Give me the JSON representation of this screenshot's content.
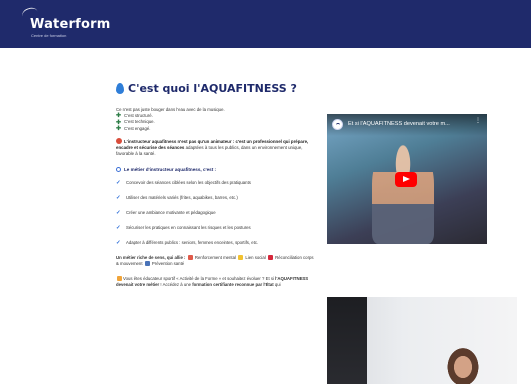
{
  "header": {
    "logo_text": "Waterform",
    "logo_subtitle": "Centre de formation"
  },
  "main": {
    "title": "C'est quoi l'AQUAFITNESS ?",
    "intro": "Ce n'est pas juste bouger dans l'eau avec de la musique.",
    "intro_items": [
      "C'est structuré.",
      "C'est technique.",
      "C'est engagé."
    ],
    "instructor_para_lead": "L'instructeur aquafitness n'est pas qu'un animateur : c'est un professionnel qui prépare, encadre et sécurise des séances",
    "instructor_para_tail": " adaptées à tous les publics, dans un environnement unique, favorable à la santé.",
    "job_heading": "Le métier d'instructeur aquafitness, c'est :",
    "job_items": [
      "Concevoir des séances ciblées selon les objectifs des pratiquants",
      "Utiliser des matériels variés (frites, aquabikes, barres, etc.)",
      "Créer une ambiance motivante et pédagogique",
      "Sécuriser les pratiques en connaissant les risques et les postures",
      "Adapter à différents publics : seniors, femmes enceintes, sportifs, etc."
    ],
    "values_lead": "Un métier riche de sens, qui allie :",
    "values_text_1": " Renforcement mental",
    "values_text_2": " Lien social",
    "values_text_3": " Réconciliation corps & mouvement",
    "values_text_4": " Prévention santé",
    "cta_1": "Vous êtes éducateur sportif « Activité de la Forme » et souhaitez évoluer ? Et si ",
    "cta_bold": "l'AQUAFITNESS devenait votre métier",
    "cta_2": " ! Accédez à une ",
    "cta_bold_2": "formation certifiante reconnue par l'État",
    "cta_3": " qui"
  },
  "video": {
    "title": "Et si l'AQUAFITNESS devenait votre m...",
    "menu_glyph": "⋮"
  },
  "colors": {
    "header_bg": "#1f2a6b",
    "accent_blue": "#2f7ed8",
    "play_red": "#ff0000"
  },
  "icons": [
    "waterform-logo-icon",
    "water-drop-icon",
    "green-cross-icon",
    "target-icon",
    "magnifier-icon",
    "check-icon",
    "play-icon"
  ]
}
